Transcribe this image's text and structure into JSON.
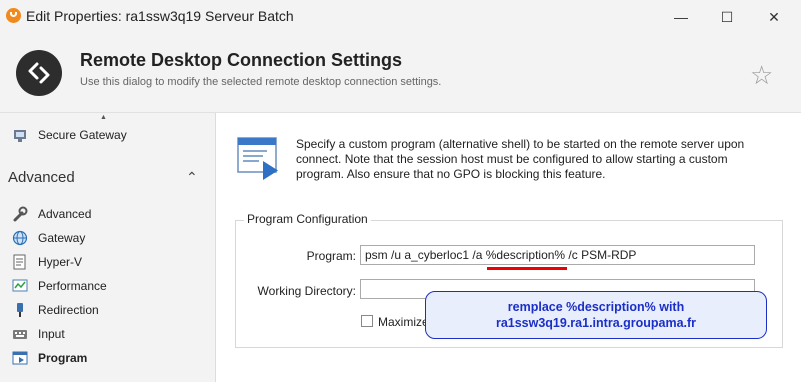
{
  "window": {
    "title": "Edit Properties: ra1ssw3q19 Serveur Batch",
    "minimize_glyph": "—",
    "maximize_glyph": "☐",
    "close_glyph": "✕"
  },
  "header": {
    "title": "Remote Desktop Connection Settings",
    "subtitle": "Use this dialog to modify the selected remote desktop connection settings.",
    "star_glyph": "☆"
  },
  "sidebar": {
    "scroll_up_glyph": "▲",
    "top_item": {
      "label": "Secure Gateway",
      "icon": "secure-gateway-icon"
    },
    "section": {
      "label": "Advanced",
      "chevron": "⌃"
    },
    "items": [
      {
        "label": "Advanced",
        "icon": "wrench-icon"
      },
      {
        "label": "Gateway",
        "icon": "globe-icon"
      },
      {
        "label": "Hyper-V",
        "icon": "hyperv-icon"
      },
      {
        "label": "Performance",
        "icon": "performance-icon"
      },
      {
        "label": "Redirection",
        "icon": "redirection-icon"
      },
      {
        "label": "Input",
        "icon": "keyboard-icon"
      },
      {
        "label": "Program",
        "icon": "program-icon",
        "selected": true
      }
    ]
  },
  "content": {
    "info": "Specify a custom program (alternative shell) to be started on the remote server upon connect. Note that the session host must be configured to allow starting a custom program. Also ensure that no GPO is blocking this feature.",
    "group_title": "Program Configuration",
    "program_label": "Program:",
    "program_value": "psm /u a_cyberloc1 /a %description% /c PSM-RDP",
    "working_dir_label": "Working Directory:",
    "working_dir_value": "",
    "maximize_label": "Maximize"
  },
  "callout": {
    "line1": "remplace %description% with",
    "line2": "ra1ssw3q19.ra1.intra.groupama.fr"
  },
  "colors": {
    "accent_blue": "#1b2fc7",
    "callout_fill": "#e8eefc",
    "highlight_red": "#e00000",
    "app_icon_orange": "#f08a1e"
  }
}
